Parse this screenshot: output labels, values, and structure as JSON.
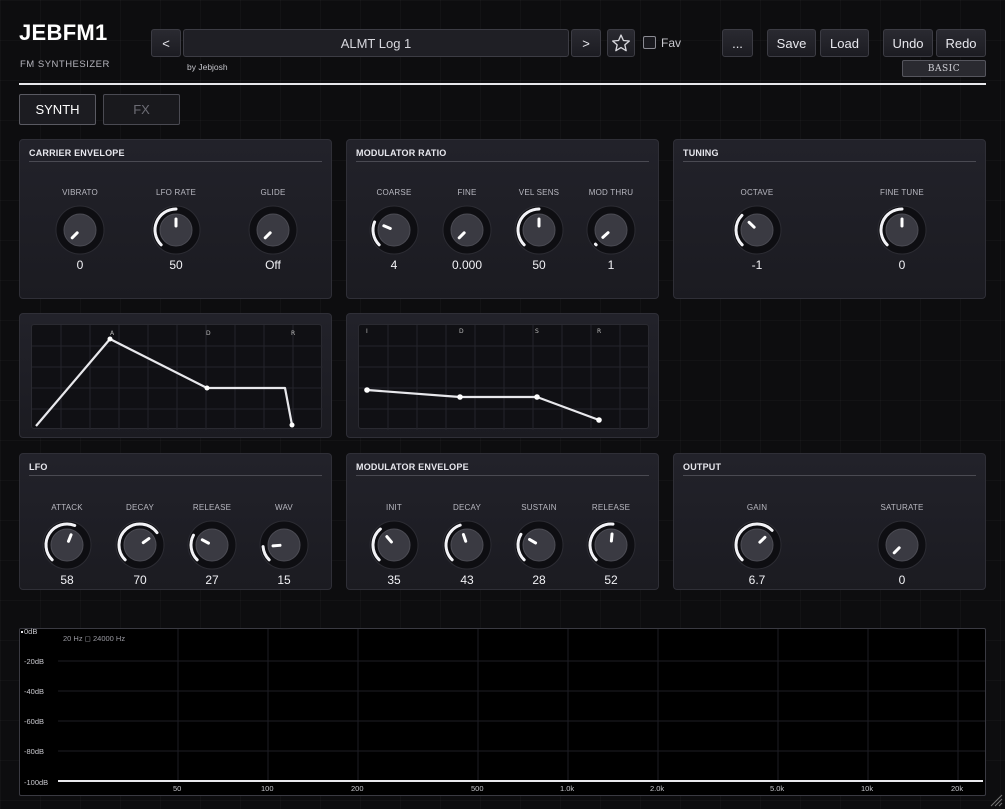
{
  "header": {
    "title": "JEBFM1",
    "subtitle": "FM SYNTHESIZER",
    "prev_label": "<",
    "next_label": ">",
    "preset_name": "ALMT Log 1",
    "author": "by Jebjosh",
    "fav_label": "Fav",
    "more_label": "...",
    "save_label": "Save",
    "load_label": "Load",
    "undo_label": "Undo",
    "redo_label": "Redo",
    "mode_label": "BASIC"
  },
  "tabs": [
    {
      "label": "SYNTH",
      "active": true
    },
    {
      "label": "FX",
      "active": false
    }
  ],
  "panels": {
    "carrier": {
      "title": "CARRIER ENVELOPE",
      "knobs": [
        {
          "label": "VIBRATO",
          "value": "0",
          "level": 0.0
        },
        {
          "label": "LFO RATE",
          "value": "50",
          "level": 0.5
        },
        {
          "label": "GLIDE",
          "value": "Off",
          "level": 0.0
        }
      ]
    },
    "ratio": {
      "title": "MODULATOR RATIO",
      "knobs": [
        {
          "label": "COARSE",
          "value": "4",
          "level": 0.25
        },
        {
          "label": "FINE",
          "value": "0.000",
          "level": 0.0
        },
        {
          "label": "VEL SENS",
          "value": "50",
          "level": 0.5
        },
        {
          "label": "MOD THRU",
          "value": "1",
          "level": 0.01
        }
      ]
    },
    "tuning": {
      "title": "TUNING",
      "knobs": [
        {
          "label": "OCTAVE",
          "value": "-1",
          "level": 0.33
        },
        {
          "label": "FINE TUNE",
          "value": "0",
          "level": 0.5
        }
      ]
    },
    "lfo": {
      "title": "LFO",
      "knobs": [
        {
          "label": "ATTACK",
          "value": "58",
          "level": 0.58
        },
        {
          "label": "DECAY",
          "value": "70",
          "level": 0.7
        },
        {
          "label": "RELEASE",
          "value": "27",
          "level": 0.27
        },
        {
          "label": "WAV",
          "value": "15",
          "level": 0.15
        }
      ]
    },
    "mod_env": {
      "title": "MODULATOR ENVELOPE",
      "knobs": [
        {
          "label": "INIT",
          "value": "35",
          "level": 0.35
        },
        {
          "label": "DECAY",
          "value": "43",
          "level": 0.43
        },
        {
          "label": "SUSTAIN",
          "value": "28",
          "level": 0.28
        },
        {
          "label": "RELEASE",
          "value": "52",
          "level": 0.52
        }
      ]
    },
    "output": {
      "title": "OUTPUT",
      "knobs": [
        {
          "label": "GAIN",
          "value": "6.7",
          "level": 0.67
        },
        {
          "label": "SATURATE",
          "value": "0",
          "level": 0.0
        }
      ]
    }
  },
  "carrier_env_graph": {
    "markers": [
      "A",
      "D",
      "R"
    ]
  },
  "mod_env_graph": {
    "markers": [
      "I",
      "D",
      "S",
      "R"
    ]
  },
  "spectrum": {
    "range_note": "20 Hz  ◻  24000 Hz",
    "db_labels": [
      "0dB",
      "-20dB",
      "-40dB",
      "-60dB",
      "-80dB",
      "-100dB"
    ],
    "freq_labels": [
      "50",
      "100",
      "200",
      "500",
      "1.0k",
      "2.0k",
      "5.0k",
      "10k",
      "20k"
    ]
  },
  "colors": {
    "accent": "#ffffff",
    "panel": "#1e1e24",
    "background": "#0d0d0f"
  }
}
